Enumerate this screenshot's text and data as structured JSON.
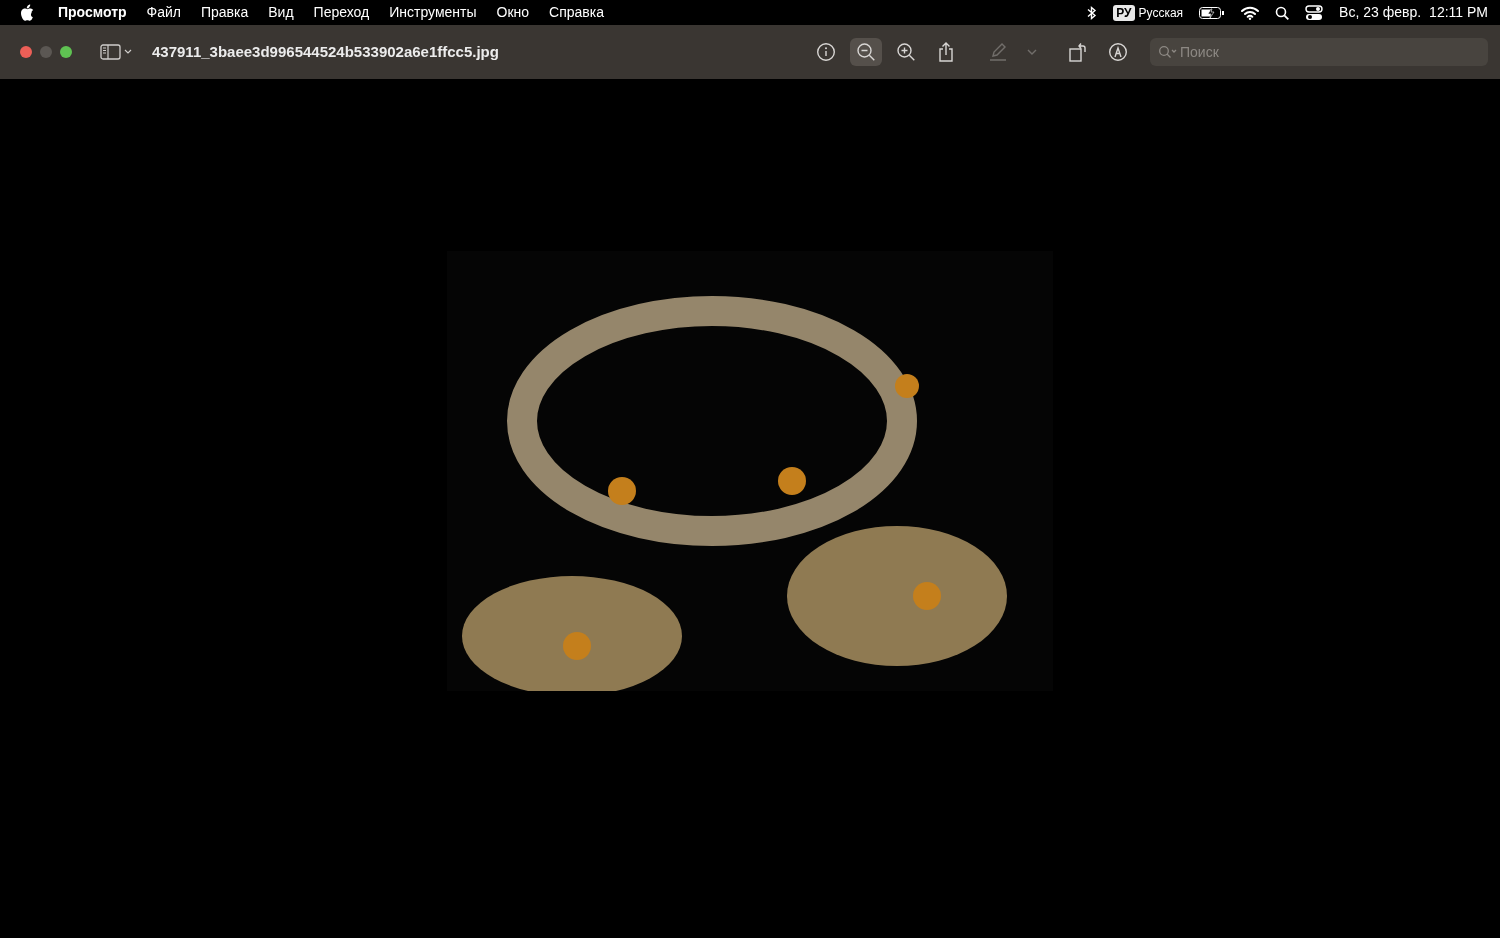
{
  "menu_bar": {
    "app_name": "Просмотр",
    "menus": [
      "Файл",
      "Правка",
      "Вид",
      "Переход",
      "Инструменты",
      "Окно",
      "Справка"
    ],
    "input_badge": "РУ",
    "input_name": "Русская",
    "date": "Вс, 23 февр.",
    "time": "12:11 PM"
  },
  "window": {
    "title": "437911_3baee3d996544524b533902a6e1ffcc5.jpg"
  },
  "toolbar": {
    "buttons": [
      {
        "kind": "info",
        "selected": false,
        "disabled": false
      },
      {
        "kind": "zoom-out",
        "selected": true,
        "disabled": false
      },
      {
        "kind": "zoom-in",
        "selected": false,
        "disabled": false
      },
      {
        "kind": "share",
        "selected": false,
        "disabled": false
      },
      {
        "kind": "highlight",
        "selected": false,
        "disabled": true
      },
      {
        "kind": "dropdown",
        "selected": false,
        "disabled": true
      },
      {
        "kind": "rotate",
        "selected": false,
        "disabled": false
      },
      {
        "kind": "markup",
        "selected": false,
        "disabled": false
      }
    ],
    "search": {
      "placeholder": "Поиск"
    }
  }
}
